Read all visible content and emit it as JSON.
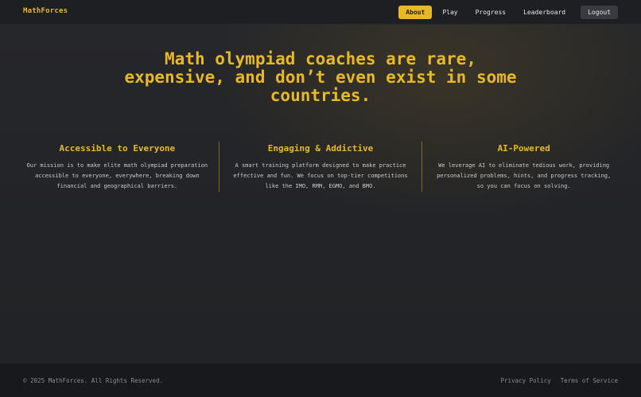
{
  "header": {
    "brand": "MathForces",
    "nav": {
      "about": "About",
      "play": "Play",
      "progress": "Progress",
      "leaderboard": "Leaderboard",
      "logout": "Logout"
    },
    "active_item": "About",
    "accent_color": "#e8b923"
  },
  "hero": {
    "headline": "Math olympiad coaches are rare, expensive, and don’t even exist in some countries."
  },
  "features": [
    {
      "title": "Accessible to Everyone",
      "text": "Our mission is to make elite math olympiad preparation accessible to everyone, everywhere, breaking down financial and geographical barriers."
    },
    {
      "title": "Engaging & Addictive",
      "text": "A smart training platform designed to make practice effective and fun. We focus on top-tier competitions like the IMO, RMM, EGMO, and BMO."
    },
    {
      "title": "AI-Powered",
      "text": "We leverage AI to eliminate tedious work, providing personalized problems, hints, and progress tracking, so you can focus on solving."
    }
  ],
  "footer": {
    "copyright": "© 2025 MathForces. All Rights Reserved.",
    "privacy": "Privacy Policy",
    "terms": "Terms of Service"
  }
}
